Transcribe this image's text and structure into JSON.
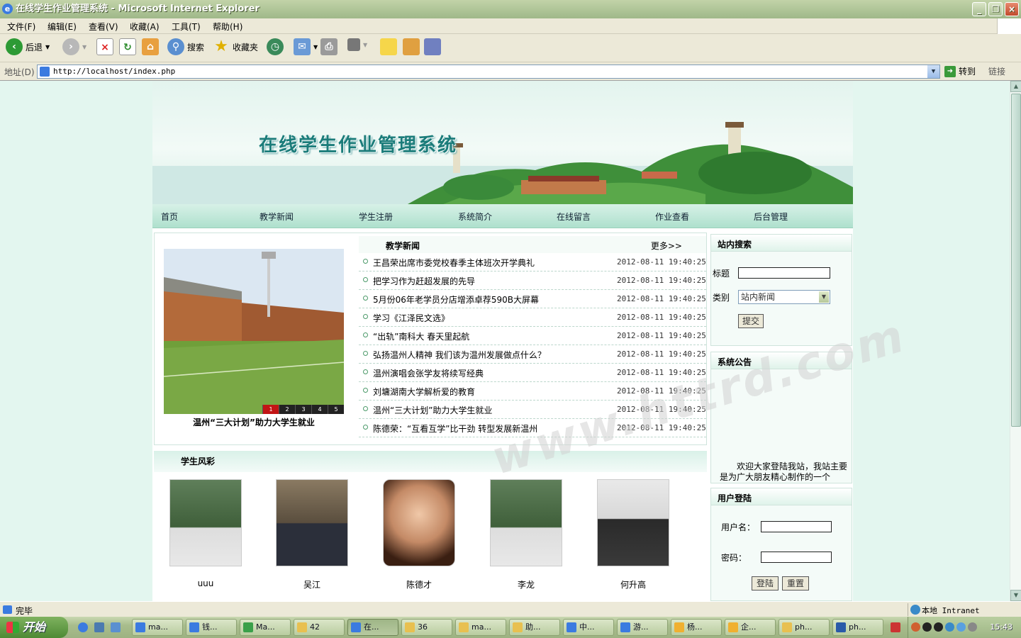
{
  "window": {
    "title": "在线学生作业管理系统 - Microsoft Internet Explorer",
    "min": "_",
    "max": "❐",
    "close": "×"
  },
  "menu": [
    "文件(F)",
    "编辑(E)",
    "查看(V)",
    "收藏(A)",
    "工具(T)",
    "帮助(H)"
  ],
  "toolbar": {
    "back": "后退",
    "search": "搜索",
    "favorites": "收藏夹"
  },
  "address": {
    "label": "地址(D)",
    "url": "http://localhost/index.php",
    "go": "转到",
    "links": "链接"
  },
  "site": {
    "banner_title": "在线学生作业管理系统",
    "nav": [
      "首页",
      "教学新闻",
      "学生注册",
      "系统简介",
      "在线留言",
      "作业查看",
      "后台管理"
    ],
    "news": {
      "heading": "教学新闻",
      "more": "更多>>",
      "caption": "温州“三大计划”助力大学生就业",
      "pages": [
        "1",
        "2",
        "3",
        "4",
        "5"
      ],
      "items": [
        {
          "title": "王昌荣出席市委党校春季主体班次开学典礼",
          "date": "2012-08-11 19:40:25"
        },
        {
          "title": "把学习作为赶超发展的先导",
          "date": "2012-08-11 19:40:25"
        },
        {
          "title": "5月份06年老学员分店增添卓荐590B大屏幕",
          "date": "2012-08-11 19:40:25"
        },
        {
          "title": "学习《江泽民文选》",
          "date": "2012-08-11 19:40:25"
        },
        {
          "title": "“出轨”南科大 春天里起航",
          "date": "2012-08-11 19:40:25"
        },
        {
          "title": "弘扬温州人精神 我们该为温州发展做点什么？",
          "date": "2012-08-11 19:40:25"
        },
        {
          "title": "温州演唱会张学友将续写经典",
          "date": "2012-08-11 19:40:25"
        },
        {
          "title": "刘墉湖南大学解析爱的教育",
          "date": "2012-08-11 19:40:25"
        },
        {
          "title": "温州“三大计划”助力大学生就业",
          "date": "2012-08-11 19:40:25"
        },
        {
          "title": "陈德荣：“互看互学”比干劲 转型发展新温州",
          "date": "2012-08-11 19:40:25"
        }
      ]
    },
    "students": {
      "heading": "学生风彩",
      "items": [
        "uuu",
        "吴江",
        "陈德才",
        "李龙",
        "何升高"
      ]
    },
    "search": {
      "heading": "站内搜索",
      "title_label": "标题",
      "category_label": "类别",
      "category_value": "站内新闻",
      "submit": "提交"
    },
    "notice": {
      "heading": "系统公告",
      "text": "欢迎大家登陆我站，我站主要是为广大朋友精心制作的一个"
    },
    "login": {
      "heading": "用户登陆",
      "username_label": "用户名：",
      "password_label": "密码：",
      "login": "登陆",
      "reset": "重置"
    },
    "watermark": "www.httrd.com"
  },
  "status": {
    "left": "完毕",
    "zone": "本地 Intranet"
  },
  "taskbar": {
    "start": "开始",
    "buttons": [
      "ma...",
      "钱...",
      "Ma...",
      "42",
      "在...",
      "36",
      "ma...",
      "助...",
      "中...",
      "游...",
      "杨...",
      "企...",
      "ph...",
      "ph..."
    ],
    "clock": "15:43"
  }
}
